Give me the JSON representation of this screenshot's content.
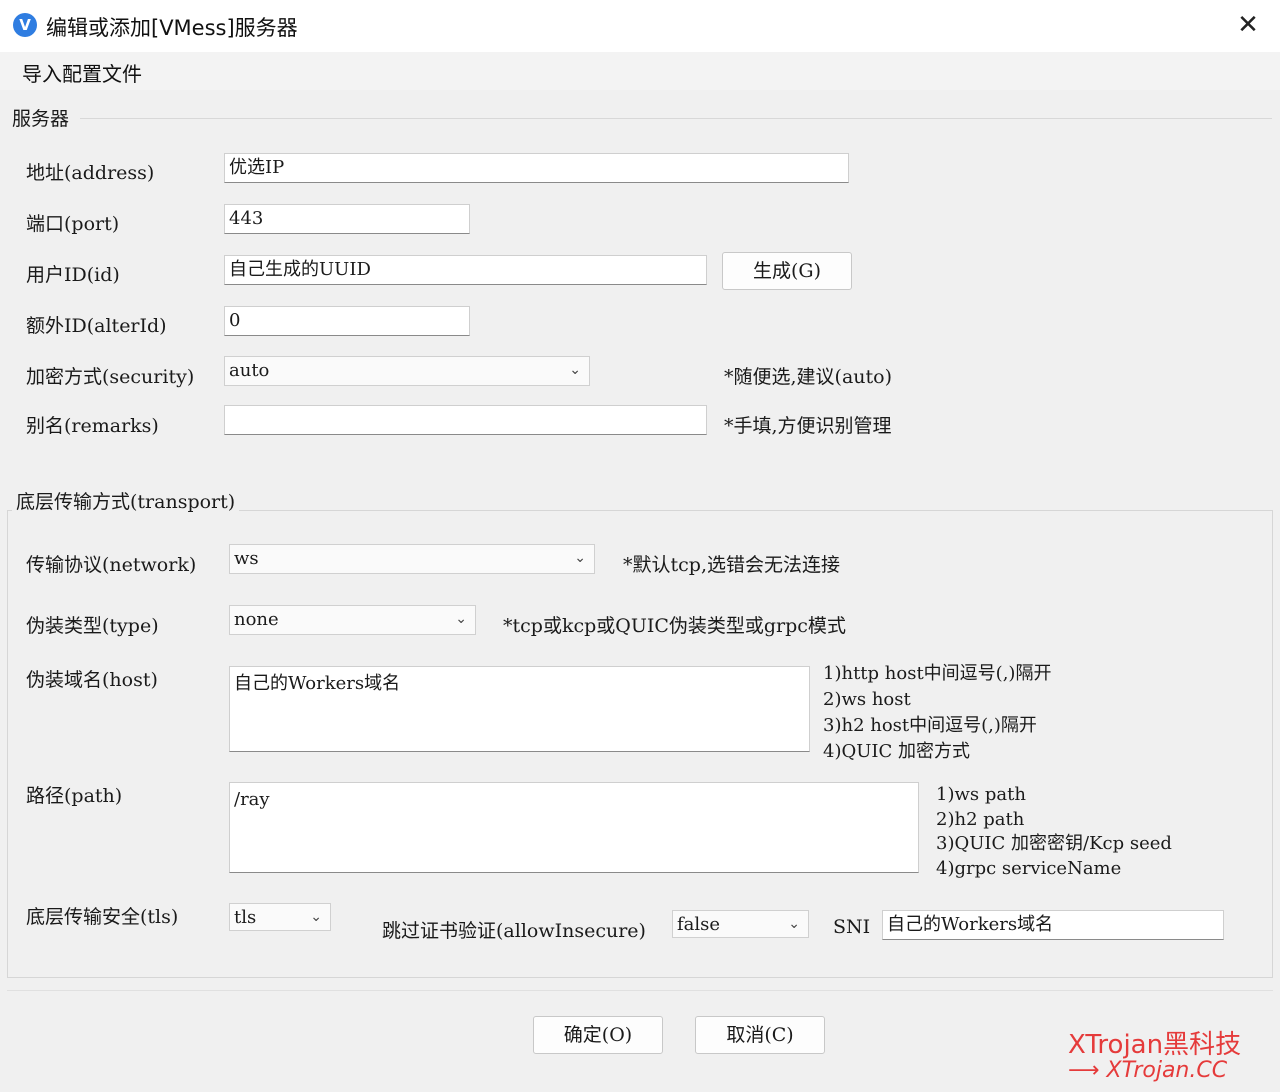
{
  "window": {
    "title": "编辑或添加[VMess]服务器",
    "icon_glyph": "V",
    "close_glyph": "✕"
  },
  "menu": {
    "import_config": "导入配置文件"
  },
  "server_group": {
    "title": "服务器",
    "address_label": "地址(address)",
    "address_value": "优选IP",
    "port_label": "端口(port)",
    "port_value": "443",
    "id_label": "用户ID(id)",
    "id_value": "自己生成的UUID",
    "generate_button": "生成(G)",
    "alter_id_label": "额外ID(alterId)",
    "alter_id_value": "0",
    "security_label": "加密方式(security)",
    "security_value": "auto",
    "security_hint": "*随便选,建议(auto)",
    "remarks_label": "别名(remarks)",
    "remarks_value": "",
    "remarks_hint": "*手填,方便识别管理"
  },
  "transport_group": {
    "title": "底层传输方式(transport)",
    "network_label": "传输协议(network)",
    "network_value": "ws",
    "network_hint": "*默认tcp,选错会无法连接",
    "type_label": "伪装类型(type)",
    "type_value": "none",
    "type_hint": "*tcp或kcp或QUIC伪装类型或grpc模式",
    "host_label": "伪装域名(host)",
    "host_value": "自己的Workers域名",
    "host_hints": [
      "1)http host中间逗号(,)隔开",
      "2)ws host",
      "3)h2 host中间逗号(,)隔开",
      "4)QUIC 加密方式"
    ],
    "path_label": "路径(path)",
    "path_value": "/ray",
    "path_hints": [
      "1)ws path",
      "2)h2 path",
      "3)QUIC 加密密钥/Kcp seed",
      "4)grpc serviceName"
    ],
    "tls_label": "底层传输安全(tls)",
    "tls_value": "tls",
    "allow_insecure_label": "跳过证书验证(allowInsecure)",
    "allow_insecure_value": "false",
    "sni_label": "SNI",
    "sni_value": "自己的Workers域名"
  },
  "footer": {
    "ok_button": "确定(O)",
    "cancel_button": "取消(C)"
  },
  "watermark": {
    "line1": "XTrojan黑科技",
    "line2": "⟶ XTrojan.CC"
  },
  "colors": {
    "accent": "#2f7de1",
    "watermark": "#e53b3b"
  }
}
